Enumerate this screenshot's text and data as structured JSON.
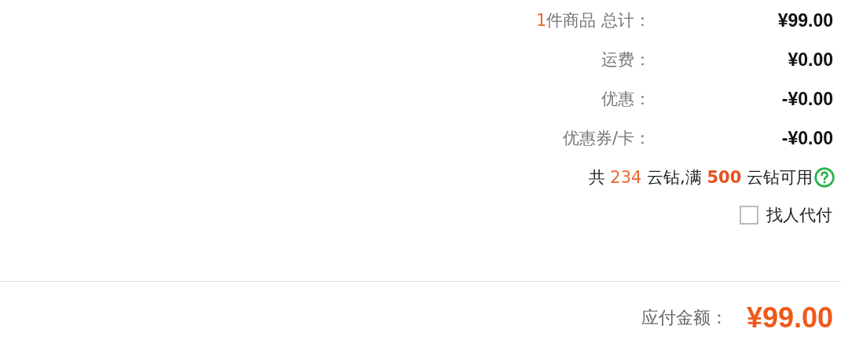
{
  "summary": {
    "item_count": "1",
    "rows": [
      {
        "label": "件商品 总计：",
        "value": "¥99.00"
      },
      {
        "label": "运费：",
        "value": "¥0.00"
      },
      {
        "label": "优惠：",
        "value": "-¥0.00"
      },
      {
        "label": "优惠券/卡：",
        "value": "-¥0.00"
      }
    ]
  },
  "coins": {
    "prefix": "共",
    "balance": "234",
    "middle": "云钻,满",
    "threshold": "500",
    "suffix": "云钻可用"
  },
  "pay_for_me": {
    "label": "找人代付",
    "checked": false
  },
  "total": {
    "label": "应付金额：",
    "value": "¥99.00"
  }
}
